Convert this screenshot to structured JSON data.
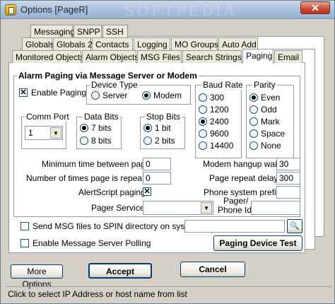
{
  "window": {
    "title": "Options [PageR]",
    "watermark": "SOFTPEDIA"
  },
  "tabs": {
    "row1": [
      "Messaging",
      "SNPP",
      "SSH"
    ],
    "row2": [
      "Globals",
      "Globals 2",
      "Contacts",
      "Logging",
      "MO Groups",
      "Auto Add"
    ],
    "row3": [
      "Monitored Objects",
      "Alarm Objects",
      "MSG Files",
      "Search Strings",
      "Paging",
      "Email"
    ],
    "active": "Paging"
  },
  "alarm_group": {
    "title": "Alarm Paging via Message Server or Modem",
    "enable_paging": {
      "label": "Enable Paging",
      "checked": true
    },
    "device_type": {
      "title": "Device Type",
      "options": [
        "Server",
        "Modem"
      ],
      "selected": "Modem"
    },
    "baud_rate": {
      "title": "Baud Rate",
      "options": [
        "300",
        "1200",
        "2400",
        "9600",
        "14400"
      ],
      "selected": "2400"
    },
    "parity": {
      "title": "Parity",
      "options": [
        "Even",
        "Odd",
        "Mark",
        "Space",
        "None"
      ],
      "selected": "Even"
    },
    "comm_port": {
      "title": "Comm Port",
      "value": "1"
    },
    "data_bits": {
      "title": "Data Bits",
      "options": [
        "7 bits",
        "8 bits"
      ],
      "selected": "7 bits"
    },
    "stop_bits": {
      "title": "Stop Bits",
      "options": [
        "1 bit",
        "2 bits"
      ],
      "selected": "1 bit"
    }
  },
  "fields": {
    "min_time_label": "Minimum time between pages",
    "min_time_value": "0",
    "times_repeated_label": "Number of times page is repeated",
    "times_repeated_value": "0",
    "alertscript_label": "AlertScript paging",
    "alertscript_checked": true,
    "pager_service_label": "Pager Service #",
    "pager_service_value": "",
    "hangup_wait_label": "Modem hangup wait",
    "hangup_wait_value": "30",
    "repeat_delay_label": "Page repeat delay",
    "repeat_delay_value": "300",
    "phone_prefix_label": "Phone system prefix",
    "phone_prefix_value": "",
    "pager_phone_label_1": "Pager/",
    "pager_phone_label_2": "Phone Id",
    "pager_phone_value": ""
  },
  "send_msg": {
    "label": "Send MSG files to SPIN directory on system:",
    "checked": false,
    "value": ""
  },
  "enable_server_polling": {
    "label": "Enable Message Server Polling",
    "checked": false
  },
  "buttons": {
    "paging_device_test": "Paging Device Test",
    "more_options": "More Options",
    "accept": "Accept",
    "cancel": "Cancel"
  },
  "status_text": "Click to select IP Address or host name from list"
}
